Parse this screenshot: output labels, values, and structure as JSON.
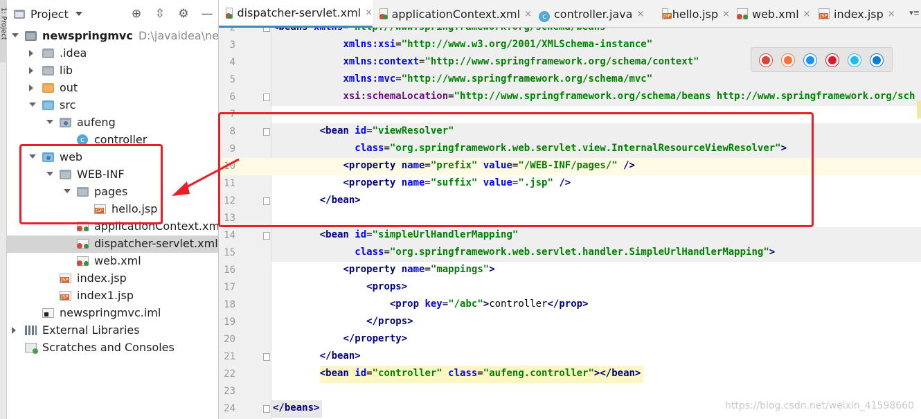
{
  "side_strip": {
    "label": "1: Project"
  },
  "project_panel": {
    "title": "Project",
    "buttons": [
      {
        "name": "crosshair-icon",
        "glyph": "⊕"
      },
      {
        "name": "collapse-all-icon",
        "glyph": "⇳"
      },
      {
        "name": "gear-icon",
        "glyph": "⚙"
      },
      {
        "name": "hide-panel-icon",
        "glyph": "—"
      }
    ]
  },
  "tree": [
    {
      "label": "newspringmvc",
      "path": "D:\\javaidea\\newspr",
      "icon": "module",
      "level": 0,
      "arrow": "open",
      "bold": true
    },
    {
      "label": ".idea",
      "icon": "folder",
      "level": 1,
      "arrow": "closed"
    },
    {
      "label": "lib",
      "icon": "folder",
      "level": 1,
      "arrow": "closed"
    },
    {
      "label": "out",
      "icon": "folder-orange",
      "level": 1,
      "arrow": "closed"
    },
    {
      "label": "src",
      "icon": "folder-blue",
      "level": 1,
      "arrow": "open"
    },
    {
      "label": "aufeng",
      "icon": "package",
      "level": 2,
      "arrow": "open"
    },
    {
      "label": "controller",
      "icon": "class",
      "level": 3,
      "arrow": ""
    },
    {
      "label": "web",
      "icon": "web-folder",
      "level": 1,
      "arrow": "open"
    },
    {
      "label": "WEB-INF",
      "icon": "folder",
      "level": 2,
      "arrow": "open"
    },
    {
      "label": "pages",
      "icon": "folder",
      "level": 3,
      "arrow": "open"
    },
    {
      "label": "hello.jsp",
      "icon": "jsp",
      "level": 4,
      "arrow": ""
    },
    {
      "label": "applicationContext.xml",
      "icon": "xml",
      "level": 3,
      "arrow": ""
    },
    {
      "label": "dispatcher-servlet.xml",
      "icon": "xml",
      "level": 3,
      "arrow": "",
      "selected": true
    },
    {
      "label": "web.xml",
      "icon": "xml",
      "level": 3,
      "arrow": ""
    },
    {
      "label": "index.jsp",
      "icon": "jsp",
      "level": 2,
      "arrow": ""
    },
    {
      "label": "index1.jsp",
      "icon": "jsp",
      "level": 2,
      "arrow": ""
    },
    {
      "label": "newspringmvc.iml",
      "icon": "iml",
      "level": 1,
      "arrow": ""
    },
    {
      "label": "External Libraries",
      "icon": "libs",
      "level": 0,
      "arrow": "closed"
    },
    {
      "label": "Scratches and Consoles",
      "icon": "scratch",
      "level": 0,
      "arrow": ""
    }
  ],
  "tabs": [
    {
      "label": "dispatcher-servlet.xml",
      "icon": "xml",
      "active": true,
      "close": "×"
    },
    {
      "label": "applicationContext.xml",
      "icon": "xml",
      "active": false,
      "close": "×"
    },
    {
      "label": "controller.java",
      "icon": "class",
      "active": false,
      "close": "×"
    },
    {
      "label": "hello.jsp",
      "icon": "jsp",
      "active": false,
      "close": "×"
    },
    {
      "label": "web.xml",
      "icon": "xml",
      "active": false,
      "close": "×"
    },
    {
      "label": "index.jsp",
      "icon": "jsp",
      "active": false,
      "close": "×"
    }
  ],
  "tab_menu_glyph": "▾≡",
  "code_lines": [
    {
      "n": "2",
      "indent": 0,
      "tokens": [
        [
          "tag",
          "<beans "
        ],
        [
          "attr",
          "xmlns"
        ],
        [
          "plain",
          "="
        ],
        [
          "val",
          "\"http://www.springframework.org/schema/beans\""
        ]
      ]
    },
    {
      "n": "3",
      "indent": 8,
      "tokens": [
        [
          "attr",
          "xmlns:xsi"
        ],
        [
          "plain",
          "="
        ],
        [
          "val",
          "\"http://www.w3.org/2001/XMLSchema-instance\""
        ]
      ]
    },
    {
      "n": "4",
      "indent": 8,
      "tokens": [
        [
          "attr",
          "xmlns:context"
        ],
        [
          "plain",
          "="
        ],
        [
          "val",
          "\"http://www.springframework.org/schema/context\""
        ]
      ]
    },
    {
      "n": "5",
      "indent": 8,
      "tokens": [
        [
          "attr",
          "xmlns:mvc"
        ],
        [
          "plain",
          "="
        ],
        [
          "val",
          "\"http://www.springframework.org/schema/mvc\""
        ]
      ]
    },
    {
      "n": "6",
      "indent": 8,
      "tokens": [
        [
          "attr2",
          "xsi:schemaLocation"
        ],
        [
          "plain",
          "="
        ],
        [
          "val",
          "\"http://www.springframework.org/schema/beans http://www.springframework.org/sch"
        ]
      ]
    },
    {
      "n": "7",
      "indent": 0,
      "tokens": []
    },
    {
      "n": "8",
      "indent": 4,
      "tokens": [
        [
          "tag",
          "<bean "
        ],
        [
          "attr",
          "id"
        ],
        [
          "plain",
          "="
        ],
        [
          "val",
          "\"viewResolver\""
        ]
      ]
    },
    {
      "n": "9",
      "indent": 10,
      "tokens": [
        [
          "attr",
          "class"
        ],
        [
          "plain",
          "="
        ],
        [
          "val",
          "\"org.springframework.web.servlet.view.InternalResourceViewResolver\""
        ],
        [
          "tag",
          ">"
        ]
      ]
    },
    {
      "n": "10",
      "indent": 8,
      "tokens": [
        [
          "tag",
          "<property "
        ],
        [
          "attr",
          "name"
        ],
        [
          "plain",
          "="
        ],
        [
          "val",
          "\"prefix\" "
        ],
        [
          "attr",
          "value"
        ],
        [
          "plain",
          "="
        ],
        [
          "val",
          "\"/WEB-INF/pages/\" "
        ],
        [
          "tag",
          "/>"
        ]
      ]
    },
    {
      "n": "11",
      "indent": 8,
      "tokens": [
        [
          "tag",
          "<property "
        ],
        [
          "attr",
          "name"
        ],
        [
          "plain",
          "="
        ],
        [
          "val",
          "\"suffix\" "
        ],
        [
          "attr",
          "value"
        ],
        [
          "plain",
          "="
        ],
        [
          "val",
          "\".jsp\" "
        ],
        [
          "tag",
          "/>"
        ]
      ]
    },
    {
      "n": "12",
      "indent": 4,
      "tokens": [
        [
          "tag",
          "</bean>"
        ]
      ]
    },
    {
      "n": "13",
      "indent": 0,
      "tokens": []
    },
    {
      "n": "14",
      "indent": 4,
      "tokens": [
        [
          "tag",
          "<bean "
        ],
        [
          "attr",
          "id"
        ],
        [
          "plain",
          "="
        ],
        [
          "val",
          "\"simpleUrlHandlerMapping\""
        ]
      ]
    },
    {
      "n": "15",
      "indent": 10,
      "tokens": [
        [
          "attr",
          "class"
        ],
        [
          "plain",
          "="
        ],
        [
          "val",
          "\"org.springframework.web.servlet.handler.SimpleUrlHandlerMapping\""
        ],
        [
          "tag",
          ">"
        ]
      ]
    },
    {
      "n": "16",
      "indent": 8,
      "tokens": [
        [
          "tag",
          "<property "
        ],
        [
          "attr",
          "name"
        ],
        [
          "plain",
          "="
        ],
        [
          "val",
          "\"mappings\""
        ],
        [
          "tag",
          ">"
        ]
      ]
    },
    {
      "n": "17",
      "indent": 12,
      "tokens": [
        [
          "tag",
          "<props>"
        ]
      ]
    },
    {
      "n": "18",
      "indent": 16,
      "tokens": [
        [
          "tag",
          "<prop "
        ],
        [
          "attr",
          "key"
        ],
        [
          "plain",
          "="
        ],
        [
          "val",
          "\"/abc\""
        ],
        [
          "tag",
          ">"
        ],
        [
          "plain",
          "controller"
        ],
        [
          "tag",
          "</prop>"
        ]
      ]
    },
    {
      "n": "19",
      "indent": 12,
      "tokens": [
        [
          "tag",
          "</props>"
        ]
      ]
    },
    {
      "n": "20",
      "indent": 8,
      "tokens": [
        [
          "tag",
          "</property>"
        ]
      ]
    },
    {
      "n": "21",
      "indent": 4,
      "tokens": [
        [
          "tag",
          "</bean>"
        ]
      ]
    },
    {
      "n": "22",
      "indent": 4,
      "tokens": [
        [
          "tag",
          "<bean "
        ],
        [
          "attr",
          "id"
        ],
        [
          "plain",
          "="
        ],
        [
          "val",
          "\"controller\" "
        ],
        [
          "attr",
          "class"
        ],
        [
          "plain",
          "="
        ],
        [
          "val",
          "\"aufeng.controller\""
        ],
        [
          "tag",
          "></bean>"
        ]
      ]
    },
    {
      "n": "23",
      "indent": 0,
      "tokens": []
    },
    {
      "n": "24",
      "indent": 0,
      "tokens": [
        [
          "tag",
          "</beans>"
        ]
      ]
    }
  ],
  "browser_icons": [
    {
      "name": "chrome-icon",
      "color": "#db4437"
    },
    {
      "name": "firefox-icon",
      "color": "#ff7139"
    },
    {
      "name": "safari-icon",
      "color": "#1e90ff"
    },
    {
      "name": "opera-icon",
      "color": "#e0162b"
    },
    {
      "name": "ie-icon",
      "color": "#1ebbee"
    },
    {
      "name": "edge-icon",
      "color": "#0a7cd6"
    }
  ],
  "watermark": "https://blog.csdn.net/weixin_41598660",
  "colors": {
    "accent": "#4083c9",
    "annotation": "#ee1c25"
  }
}
